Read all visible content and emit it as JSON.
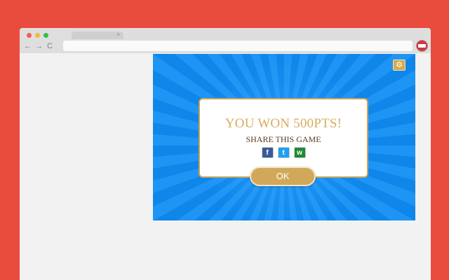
{
  "browser": {
    "tab_close": "×",
    "nav": {
      "back": "←",
      "forward": "→",
      "reload": "C"
    },
    "icons": [
      "close-icon",
      "back-arrow-icon",
      "forward-arrow-icon",
      "reload-icon",
      "extension-icon"
    ]
  },
  "game": {
    "settings_icon": "⚙",
    "modal": {
      "title": "YOU WON 500PTS!",
      "share_label": "SHARE THIS GAME",
      "social": {
        "facebook": "f",
        "twitter": "t",
        "whatsapp": "w"
      },
      "ok_label": "OK"
    }
  },
  "colors": {
    "page_background": "#e94b3c",
    "game_blue": "#1e95f4",
    "gold": "#d1a85a",
    "title_gold": "#d8ac60",
    "share_brown": "#5b3a1e"
  }
}
